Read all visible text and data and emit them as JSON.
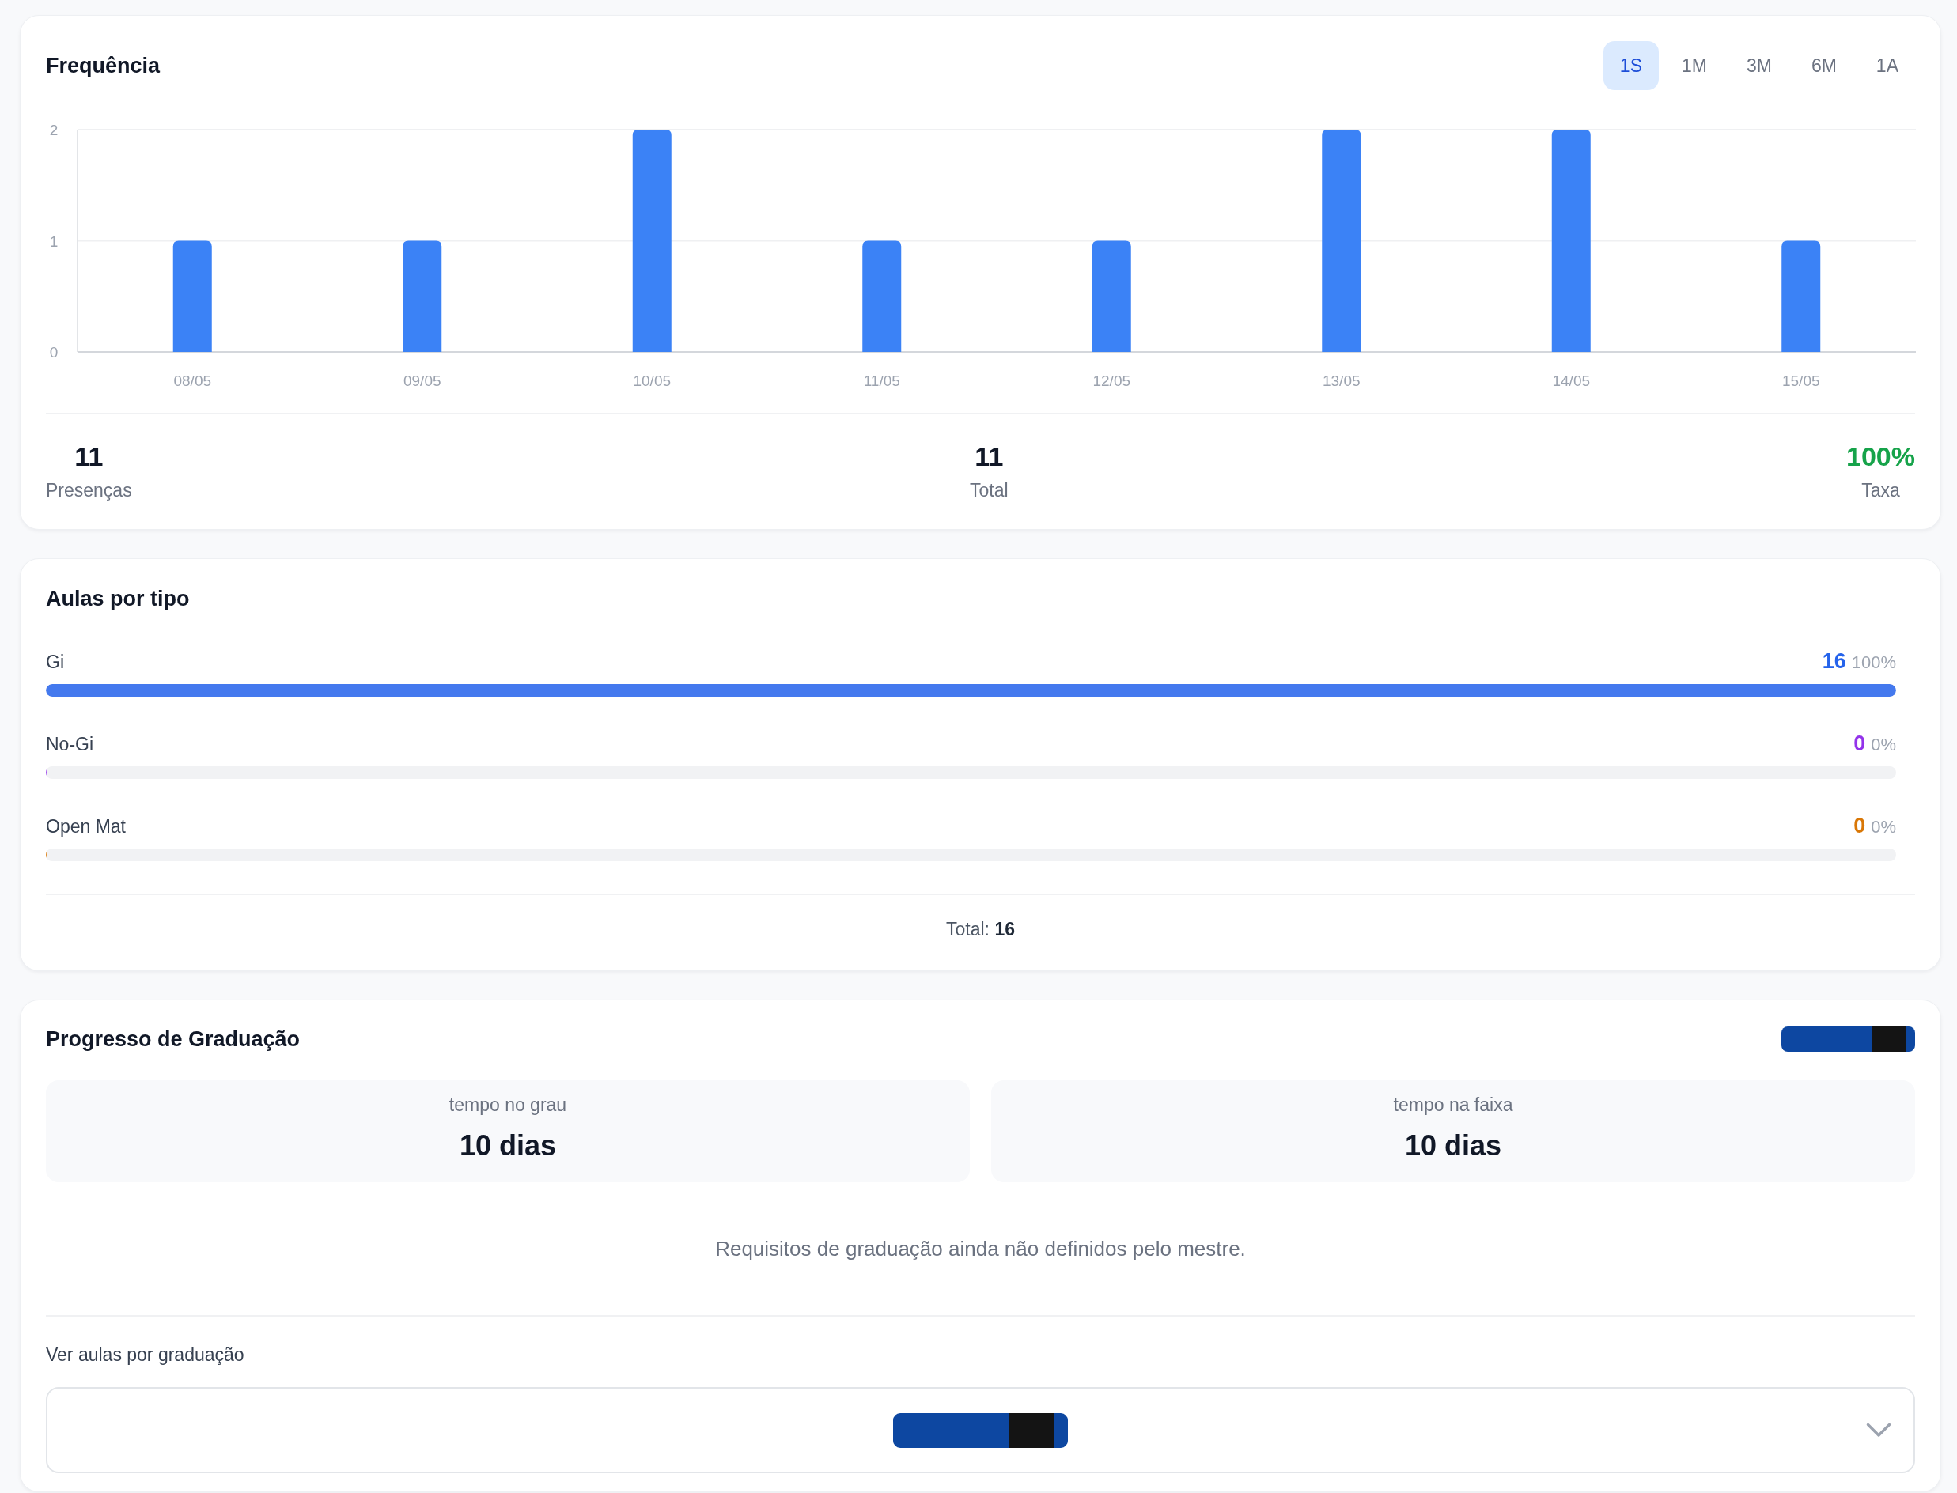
{
  "attendance": {
    "title": "Frequência",
    "period_tabs": [
      {
        "label": "1S",
        "selected": true
      },
      {
        "label": "1M",
        "selected": false
      },
      {
        "label": "3M",
        "selected": false
      },
      {
        "label": "6M",
        "selected": false
      },
      {
        "label": "1A",
        "selected": false
      }
    ],
    "chart_data": {
      "type": "bar",
      "categories": [
        "08/05",
        "09/05",
        "10/05",
        "11/05",
        "12/05",
        "13/05",
        "14/05",
        "15/05"
      ],
      "values": [
        1,
        1,
        2,
        1,
        1,
        2,
        2,
        1
      ],
      "ylim": [
        0,
        2
      ],
      "yticks": [
        0,
        1,
        2
      ]
    },
    "stats": [
      {
        "value": "11",
        "label": "Presenças",
        "color": "#111827"
      },
      {
        "value": "11",
        "label": "Total",
        "color": "#111827"
      },
      {
        "value": "100%",
        "label": "Taxa",
        "color": "#16a34a"
      }
    ]
  },
  "class_types": {
    "title": "Aulas por tipo",
    "items": [
      {
        "name": "Gi",
        "count": "16",
        "percent": "100%",
        "level": 1,
        "color": "#2563eb"
      },
      {
        "name": "No-Gi",
        "count": "0",
        "percent": "0%",
        "level": 0,
        "color": "#9333ea"
      },
      {
        "name": "Open Mat",
        "count": "0",
        "percent": "0%",
        "level": 0,
        "color": "#d97706"
      }
    ],
    "total": "Total: **16**"
  },
  "graduation": {
    "title": "Progresso de Graduação",
    "durations": [
      {
        "label": "tempo no grau",
        "value": "10 dias"
      },
      {
        "label": "tempo na faixa",
        "value": "10 dias"
      }
    ],
    "message": "Requisitos de graduação ainda não definidos pelo mestre.",
    "select_label": "Ver aulas por graduação"
  }
}
